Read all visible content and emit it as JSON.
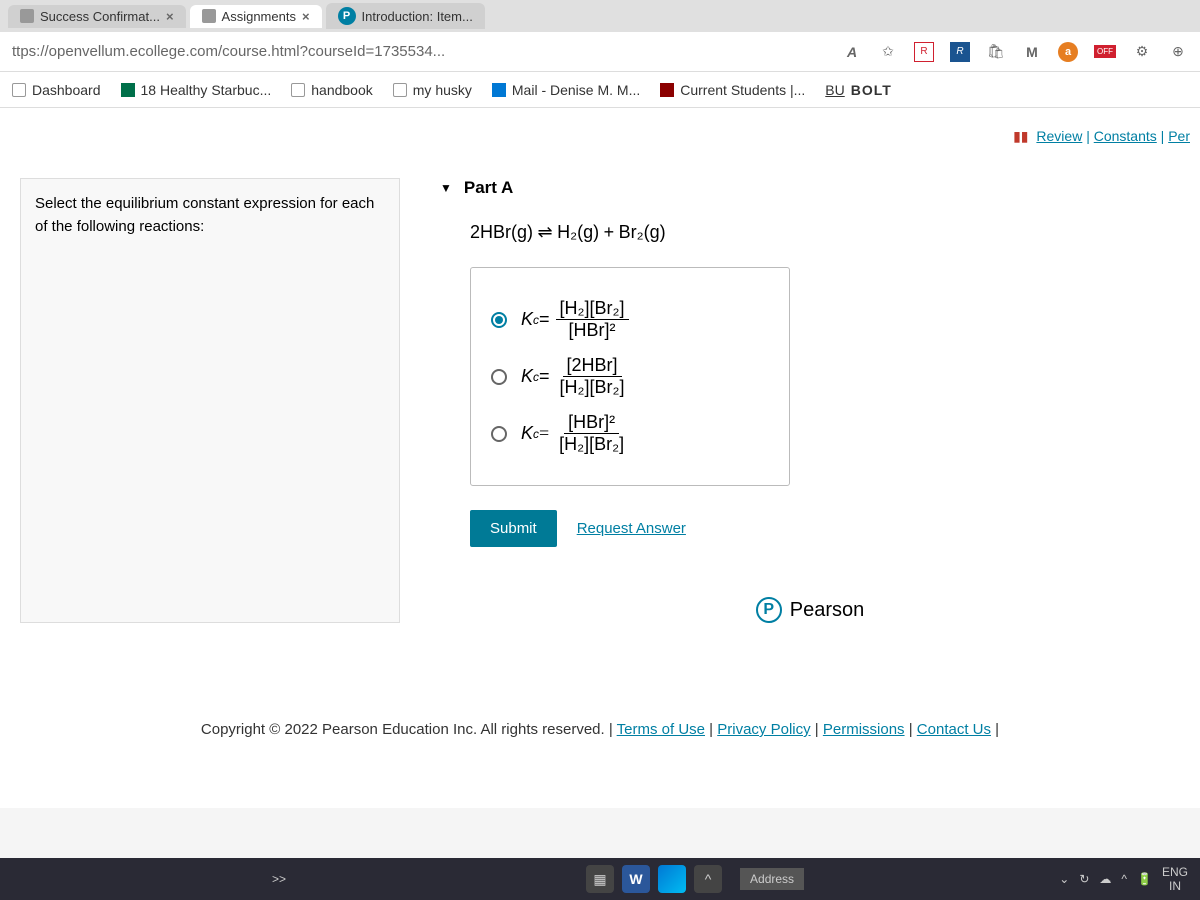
{
  "tabs": {
    "tab1": "Success Confirmat...",
    "tab2": "Assignments",
    "tab3": "Introduction: Item..."
  },
  "url": "ttps://openvellum.ecollege.com/course.html?courseId=1735534...",
  "url_icons": {
    "a": "A",
    "r1": "R",
    "r2": "R",
    "m": "M",
    "a2": "a",
    "off": "OFF"
  },
  "bookmarks": {
    "dashboard": "Dashboard",
    "starbucks": "18 Healthy Starbuc...",
    "handbook": "handbook",
    "myhusky": "my husky",
    "mail": "Mail - Denise M. M...",
    "students": "Current Students |...",
    "bolt_bu": "BU",
    "bolt": "BOLT"
  },
  "top_links": {
    "review": " Review",
    "constants": "Constants",
    "per": "Per"
  },
  "question": "Select the equilibrium constant expression for each of the following reactions:",
  "part_label": "Part A",
  "equation": {
    "left": "2HBr(g)",
    "arrow": "⇌",
    "right_h2": "H₂(g)",
    "plus": "+",
    "right_br2": "Br₂(g)"
  },
  "options": {
    "kc": "K",
    "kc_sub": "c",
    "equals": " = ",
    "opt1_top": "[H₂][Br₂]",
    "opt1_bot": "[HBr]²",
    "opt2_top": "[2HBr]",
    "opt2_bot": "[H₂][Br₂]",
    "opt3_top": "[HBr]²",
    "opt3_bot": "[H₂][Br₂]"
  },
  "buttons": {
    "submit": "Submit",
    "request": "Request Answer"
  },
  "pearson_label": "Pearson",
  "pearson_p": "P",
  "copyright": {
    "text": "Copyright © 2022 Pearson Education Inc. All rights reserved. | ",
    "terms": "Terms of Use",
    "privacy": "Privacy Policy",
    "permissions": "Permissions",
    "contact": "Contact Us",
    "sep": " | "
  },
  "taskbar": {
    "expand": ">>",
    "word": "W",
    "address": "Address",
    "lang1": "ENG",
    "lang2": "IN",
    "caret": "^"
  }
}
